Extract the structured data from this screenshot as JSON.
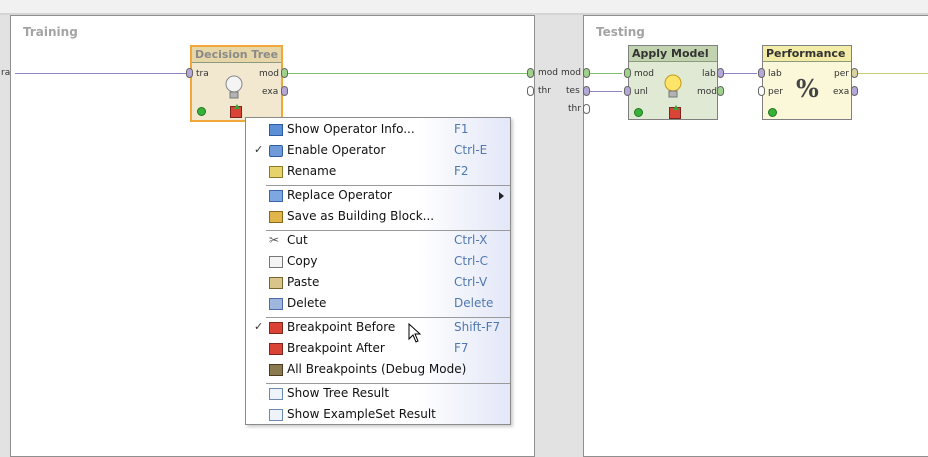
{
  "panels": {
    "training_title": "Training",
    "testing_title": "Testing"
  },
  "ports_outer": {
    "left_partial": "ra",
    "mod_left": "mod",
    "mod_right": "mod",
    "thr_left": "thr",
    "tes_right": "tes",
    "thr_right": "thr"
  },
  "operators": {
    "decision_tree": {
      "title": "Decision Tree",
      "in_ports": [
        "tra"
      ],
      "out_ports": [
        "mod",
        "exa"
      ]
    },
    "apply_model": {
      "title": "Apply Model",
      "in_ports": [
        "mod",
        "unl"
      ],
      "out_ports": [
        "lab",
        "mod"
      ]
    },
    "performance": {
      "title": "Performance",
      "in_ports": [
        "lab",
        "per"
      ],
      "out_ports": [
        "per",
        "exa"
      ],
      "symbol": "%"
    }
  },
  "context_menu": {
    "items": [
      {
        "label": "Show Operator Info...",
        "shortcut": "F1",
        "icon": "info-icon",
        "checked": false
      },
      {
        "label": "Enable Operator",
        "shortcut": "Ctrl-E",
        "icon": "enable-icon",
        "checked": true
      },
      {
        "label": "Rename",
        "shortcut": "F2",
        "icon": "rename-icon",
        "checked": false
      },
      {
        "label": "Replace Operator",
        "shortcut": "",
        "icon": "replace-icon",
        "checked": false,
        "submenu": true
      },
      {
        "label": "Save as Building Block...",
        "shortcut": "",
        "icon": "building-block-icon",
        "checked": false
      },
      {
        "label": "Cut",
        "shortcut": "Ctrl-X",
        "icon": "scissors-icon",
        "checked": false
      },
      {
        "label": "Copy",
        "shortcut": "Ctrl-C",
        "icon": "copy-icon",
        "checked": false
      },
      {
        "label": "Paste",
        "shortcut": "Ctrl-V",
        "icon": "paste-icon",
        "checked": false
      },
      {
        "label": "Delete",
        "shortcut": "Delete",
        "icon": "delete-icon",
        "checked": false
      },
      {
        "label": "Breakpoint Before",
        "shortcut": "Shift-F7",
        "icon": "breakpoint-before-icon",
        "checked": true
      },
      {
        "label": "Breakpoint After",
        "shortcut": "F7",
        "icon": "breakpoint-after-icon",
        "checked": false
      },
      {
        "label": "All Breakpoints (Debug Mode)",
        "shortcut": "",
        "icon": "all-breakpoints-icon",
        "checked": false
      },
      {
        "label": "Show Tree Result",
        "shortcut": "",
        "icon": "tree-result-icon",
        "checked": false
      },
      {
        "label": "Show ExampleSet Result",
        "shortcut": "",
        "icon": "exampleset-result-icon",
        "checked": false
      }
    ],
    "check_mark": "✓"
  },
  "colors": {
    "accent": "#f2a73b",
    "shortcut": "#4f78b0",
    "port": "#b5a8d8",
    "connection_model": "#7fbf6f",
    "connection_data": "#8f84c8"
  }
}
